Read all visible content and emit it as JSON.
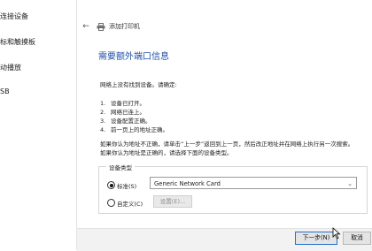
{
  "sidebar": {
    "items": [
      {
        "label": "连接设备"
      },
      {
        "label": "标和触摸板"
      },
      {
        "label": "动播放"
      },
      {
        "label": "SB"
      }
    ]
  },
  "dialog": {
    "title": "添加打印机",
    "heading": "需要额外端口信息",
    "intro": "网络上没有找到设备。请确定:",
    "checklist": [
      {
        "num": "1.",
        "text": "设备已打开。"
      },
      {
        "num": "2.",
        "text": "网络已连上。"
      },
      {
        "num": "3.",
        "text": "设备配置正确。"
      },
      {
        "num": "4.",
        "text": "前一页上的地址正确。"
      }
    ],
    "para1": "如果你认为地址不正确，请单击“上一步”返回到上一页，然后改正地址并在网络上执行另一次搜索。",
    "para2": "如果你认为地址是正确的，请选择下面的设备类型。",
    "device_type": {
      "group_label": "设备类型",
      "standard_label": "标准(S)",
      "standard_value": "Generic Network Card",
      "custom_label": "自定义(C)",
      "settings_label": "设置(E)..."
    },
    "next_label": "下一步(N)",
    "cancel_label": "取消"
  }
}
